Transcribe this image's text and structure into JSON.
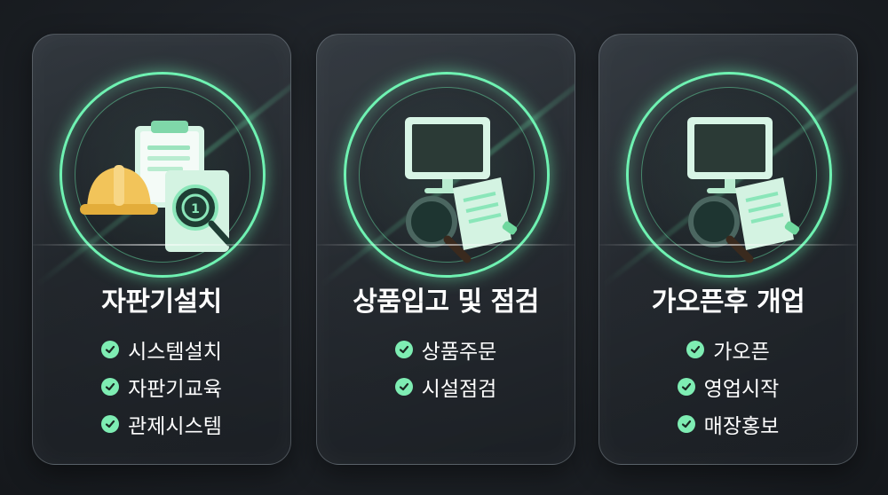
{
  "colors": {
    "accent": "#6ff2b2",
    "check_bg": "#7eedb3",
    "background": "#1c2025",
    "text": "#ffffff"
  },
  "cards": [
    {
      "title": "자판기설치",
      "icon": "hardhat-clipboard-certificate-icon",
      "items": [
        "시스템설치",
        "자판기교육",
        "관제시스템"
      ]
    },
    {
      "title": "상품입고 및 점검",
      "icon": "monitor-magnifier-document-icon",
      "items": [
        "상품주문",
        "시설점검"
      ]
    },
    {
      "title": "가오픈후 개업",
      "icon": "monitor-magnifier-document-icon",
      "items": [
        "가오픈",
        "영업시작",
        "매장홍보"
      ]
    }
  ]
}
